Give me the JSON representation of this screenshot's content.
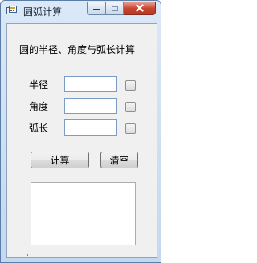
{
  "window": {
    "title": "圆弧计算"
  },
  "form": {
    "heading": "圆的半径、角度与弧长计算",
    "rows": [
      {
        "label": "半径",
        "value": ""
      },
      {
        "label": "角度",
        "value": ""
      },
      {
        "label": "弧长",
        "value": ""
      }
    ],
    "calc_label": "计算",
    "clear_label": "清空",
    "result_text": ""
  },
  "icons": {
    "app": "calculator-app-icon",
    "minimize": "minimize-icon",
    "maximize": "maximize-icon",
    "close": "close-icon"
  },
  "colors": {
    "titlebar": "#c4d8ef",
    "close_button": "#c8442e",
    "client_background": "#f0f0f0"
  }
}
